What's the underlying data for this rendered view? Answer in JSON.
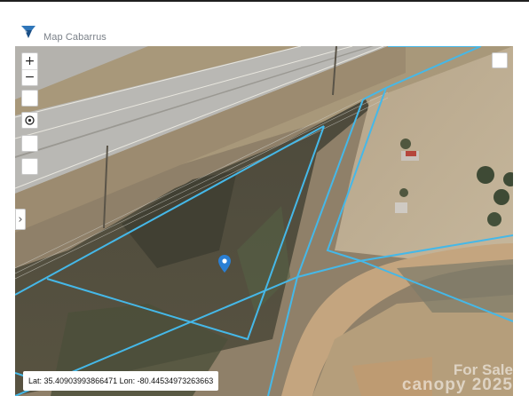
{
  "header": {
    "title": "Map Cabarrus"
  },
  "map": {
    "controls": {
      "zoom_in": "+",
      "zoom_out": "−",
      "expand_arrow": "›"
    },
    "coordinates": {
      "text": "Lat: 35.40903993866471 Lon: -80.44534973263663"
    },
    "watermark": {
      "line1": "For Sale",
      "line2": "canopy 2025"
    },
    "colors": {
      "parcel_lines": "#45b8e8",
      "marker": "#2a7fd4"
    }
  }
}
